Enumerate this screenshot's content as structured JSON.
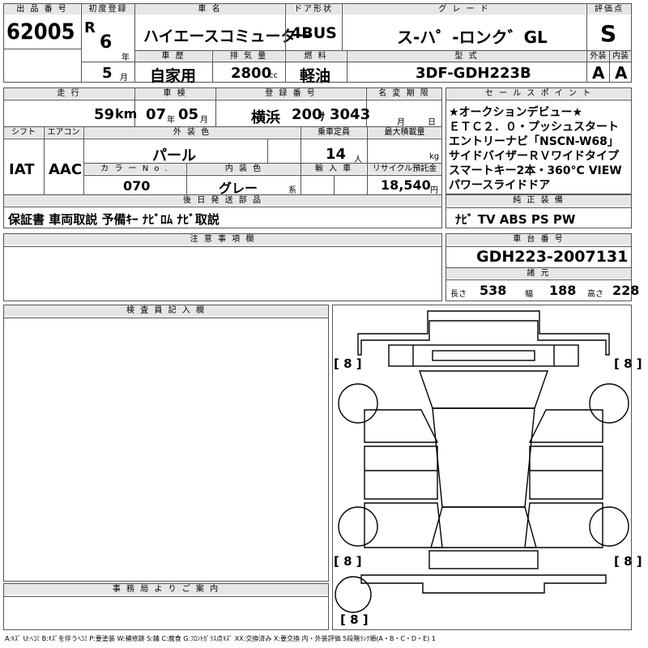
{
  "top": {
    "lot_label": "出 品 番 号",
    "lot_no": "62005",
    "first_reg_label": "初度登録",
    "era": "R",
    "year": "6",
    "year_unit": "年",
    "month": "5",
    "month_unit": "月",
    "car_name_label": "車 名",
    "car_name": "ハイエースコミューター",
    "door_label": "ドア形状",
    "door": "4BUS",
    "grade_label": "グ レ ー ド",
    "grade": "ス-ハ゜-ロンク゛GL",
    "score_label": "評価点",
    "score": "S",
    "history_label": "車 歴",
    "history": "自家用",
    "displacement_label": "排 気 量",
    "displacement": "2800",
    "cc": "cc",
    "fuel_label": "燃 料",
    "fuel": "軽油",
    "model_label": "型 式",
    "model": "3DF-GDH223B",
    "exterior_label": "外装",
    "interior_label": "内装",
    "exterior": "A",
    "interior": "A"
  },
  "row2": {
    "mileage_label": "走 行",
    "mileage": "59",
    "km": "km",
    "inspection_label": "車 検",
    "insp_year": "07",
    "insp_year_unit": "年",
    "insp_month": "05",
    "insp_month_unit": "月",
    "reg_label": "登 録 番 号",
    "reg_place": "横浜",
    "reg_class": "200",
    "reg_kana": "ｻ",
    "reg_num": "3043",
    "name_change_label": "名 変 期 限",
    "nc_month": "月",
    "nc_day": "日"
  },
  "row3": {
    "shift_label": "シフト",
    "shift": "IAT",
    "ac_label": "エアコン",
    "ac": "AAC",
    "exterior_color_label": "外 装 色",
    "exterior_color": "パール",
    "capacity_label": "乗車定員",
    "capacity": "14",
    "capacity_unit": "人",
    "max_load_label": "最大積載量",
    "max_load_unit": "kg",
    "color_no_label": "カ ラ ー N o .",
    "color_no": "070",
    "interior_color_label": "内 装 色",
    "interior_color": "グレー",
    "interior_color_unit": "系",
    "import_label": "輸 入 車",
    "recycle_label": "リサイクル預託金",
    "recycle": "18,540",
    "recycle_unit": "円"
  },
  "sales_points": {
    "label": "セ ー ル ス ポ イ ン ト",
    "lines": [
      "★オークションデビュー★",
      "ＥＴＣ２．０・プッシュスタート",
      "エントリーナビ「NSCN-W68」",
      "サイドバイザーＲＶワイドタイプ",
      "スマートキー2本・360°C VIEW",
      "パワースライドドア"
    ]
  },
  "later_parts": {
    "label": "後 日 発 送 部 品",
    "value": "保証書 車両取説 予備ｷｰ ﾅﾋﾞﾛﾑ ﾅﾋﾞ取説"
  },
  "equipment": {
    "label": "純 正 装 備",
    "value": "ﾅﾋﾞ TV ABS PS PW"
  },
  "notes": {
    "label": "注 意 事 項 欄",
    "value": ""
  },
  "chassis": {
    "label": "車 台 番 号",
    "value": "GDH223-2007131"
  },
  "dims": {
    "label": "諸 元",
    "length_label": "長さ",
    "length": "538",
    "width_label": "幅",
    "width": "188",
    "height_label": "高さ",
    "height": "228"
  },
  "inspector": {
    "label": "検 査 員 記 入 欄"
  },
  "office": {
    "label": "事 務 局 よ り ご 案 内"
  },
  "tires": [
    "[ 8 ]",
    "[ 8 ]",
    "[ 8 ]",
    "[ 8 ]",
    "[ 8 ]"
  ],
  "legend": "A:ｷｽﾞ U:ﾍｺﾐ B:ｷｽﾞを伴うﾍｺﾐ P:要塗装 W:補修跡 S:錆 C:腐食 G:ﾌﾛﾝﾄｶﾞﾗｽ点ｷｽﾞ XX:交換済み X:要交換 内・外装評価 5段階ﾗﾝｸ順(A・B・C・D・E) 1"
}
